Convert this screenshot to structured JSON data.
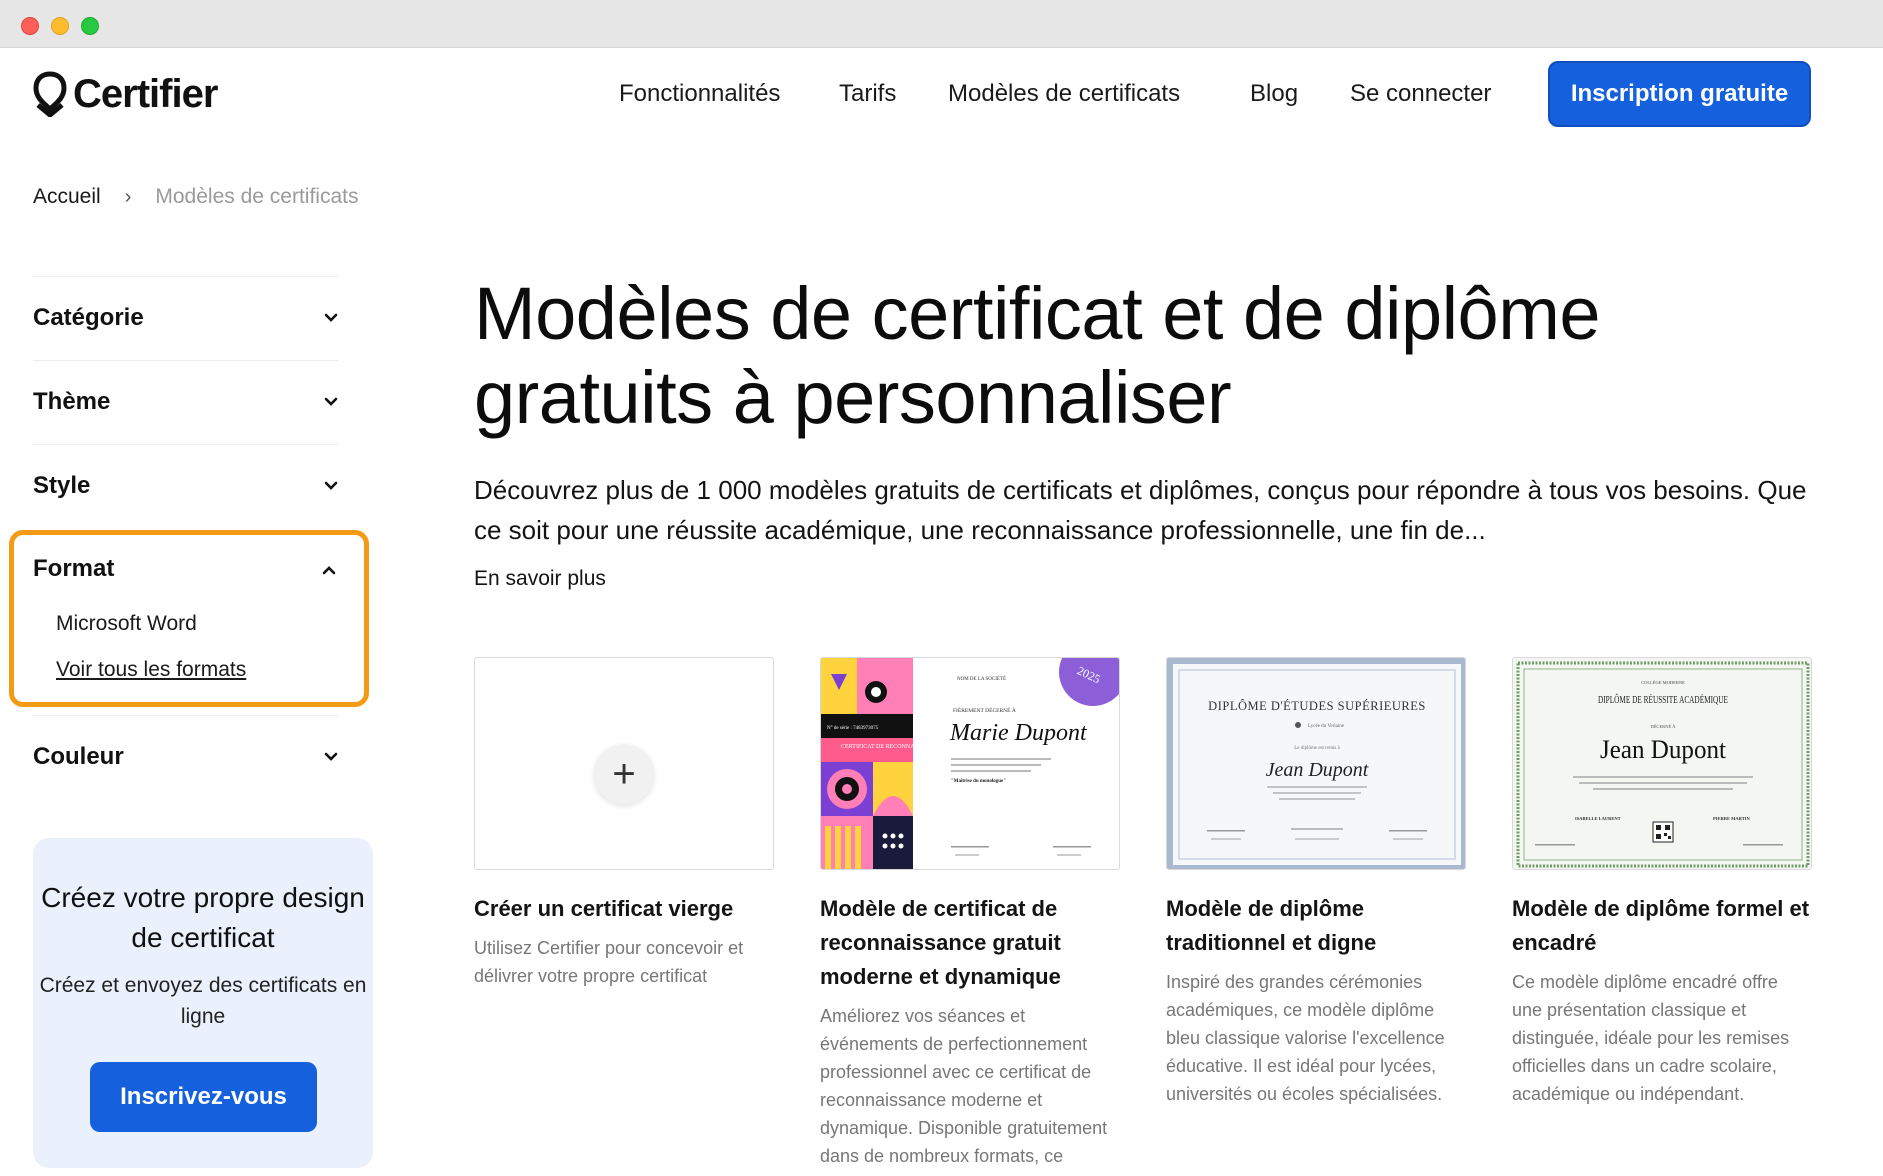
{
  "brand": {
    "name": "Certifier",
    "accent": "#1560dd",
    "highlight": "#f59a14"
  },
  "nav": {
    "items": [
      "Fonctionnalités",
      "Tarifs",
      "Modèles de certificats",
      "Blog",
      "Se connecter"
    ],
    "cta": "Inscription gratuite"
  },
  "breadcrumb": {
    "home": "Accueil",
    "separator": "›",
    "current": "Modèles de certificats"
  },
  "sidebar": {
    "filters": [
      "Catégorie",
      "Thème",
      "Style"
    ],
    "format": {
      "label": "Format",
      "items": [
        "Microsoft Word",
        "Voir tous les formats"
      ]
    },
    "color_filter": "Couleur",
    "promo": {
      "title": "Créez votre propre design de certificat",
      "subtitle": "Créez et envoyez des certificats en ligne",
      "button": "Inscrivez-vous"
    }
  },
  "main": {
    "title": "Modèles de certificat et de diplôme gratuits à personnaliser",
    "intro": "Découvrez plus de 1 000 modèles gratuits de certificats et diplômes, conçus pour répondre à tous vos besoins. Que ce soit pour une réussite académique, une reconnaissance professionnelle, une fin de...",
    "more": "En savoir plus"
  },
  "cards": [
    {
      "title": "Créer un certificat vierge",
      "desc": "Utilisez Certifier pour concevoir et délivrer votre propre certificat",
      "icon": "plus-icon"
    },
    {
      "title": "Modèle de certificat de reconnaissance gratuit moderne et dynamique",
      "desc": "Améliorez vos séances et événements de perfectionnement professionnel avec ce certificat de reconnaissance moderne et dynamique. Disponible gratuitement dans de nombreux formats, ce modèle peut être",
      "thumb": {
        "year": "2025",
        "company": "NOM DE LA SOCIÉTÉ",
        "award": "FIÈREMENT DÉCERNÉ À",
        "serial": "N° de série : 7483973075",
        "type": "CERTIFICAT DE RECONNAISSANCE",
        "name": "Marie Dupont",
        "course": "\"Maîtrise du monologue\""
      }
    },
    {
      "title": "Modèle de diplôme traditionnel et digne",
      "desc": "Inspiré des grandes cérémonies académiques, ce modèle diplôme bleu classique valorise l'excellence éducative. Il est idéal pour lycées, universités ou écoles spécialisées.",
      "thumb": {
        "heading": "DIPLÔME D'ÉTUDES SUPÉRIEURES",
        "school": "Lycée du Verlaine",
        "line": "Le diplôme est remis à",
        "name": "Jean Dupont"
      }
    },
    {
      "title": "Modèle de diplôme formel et encadré",
      "desc": "Ce modèle diplôme encadré offre une présentation classique et distinguée, idéale pour les remises officielles dans un cadre scolaire, académique ou indépendant.",
      "thumb": {
        "school": "COLLÈGE MODERNE",
        "heading": "DIPLÔME DE RÉUSSITE ACADÉMIQUE",
        "award": "DÉCERNÉ À",
        "name": "Jean Dupont",
        "sig_left": "ISABELLE LAURENT",
        "sig_right": "PIERRE MARTIN"
      }
    }
  ]
}
